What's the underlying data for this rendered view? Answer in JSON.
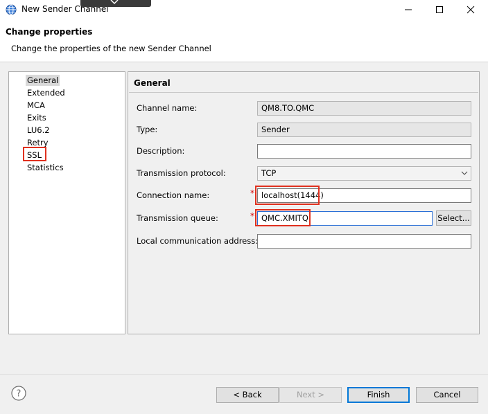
{
  "window": {
    "title": "New Sender Channel"
  },
  "header": {
    "title": "Change properties",
    "subtitle": "Change the properties of the new Sender Channel"
  },
  "nav": {
    "items": [
      {
        "label": "General",
        "selected": true
      },
      {
        "label": "Extended"
      },
      {
        "label": "MCA"
      },
      {
        "label": "Exits"
      },
      {
        "label": "LU6.2"
      },
      {
        "label": "Retry"
      },
      {
        "label": "SSL",
        "highlighted": true
      },
      {
        "label": "Statistics"
      }
    ]
  },
  "general": {
    "section_title": "General",
    "channel_name": {
      "label": "Channel name:",
      "value": "QM8.TO.QMC"
    },
    "type": {
      "label": "Type:",
      "value": "Sender"
    },
    "description": {
      "label": "Description:",
      "value": ""
    },
    "transmission_protocol": {
      "label": "Transmission protocol:",
      "value": "TCP"
    },
    "connection_name": {
      "label": "Connection name:",
      "value": "localhost(1444)",
      "required_mark": "*"
    },
    "transmission_queue": {
      "label": "Transmission queue:",
      "value": "QMC.XMITQ",
      "required_mark": "*",
      "select_label": "Select..."
    },
    "local_address": {
      "label": "Local communication address:",
      "value": ""
    }
  },
  "footer": {
    "back_label": "< Back",
    "next_label": "Next >",
    "finish_label": "Finish",
    "cancel_label": "Cancel"
  },
  "icons": {
    "app": "globe-icon",
    "help": "help-icon",
    "minimize": "minimize-icon",
    "maximize": "maximize-icon",
    "close": "close-icon"
  },
  "colors": {
    "highlight": "#e0301e",
    "required": "#d40000",
    "focus": "#2a6fd6"
  }
}
